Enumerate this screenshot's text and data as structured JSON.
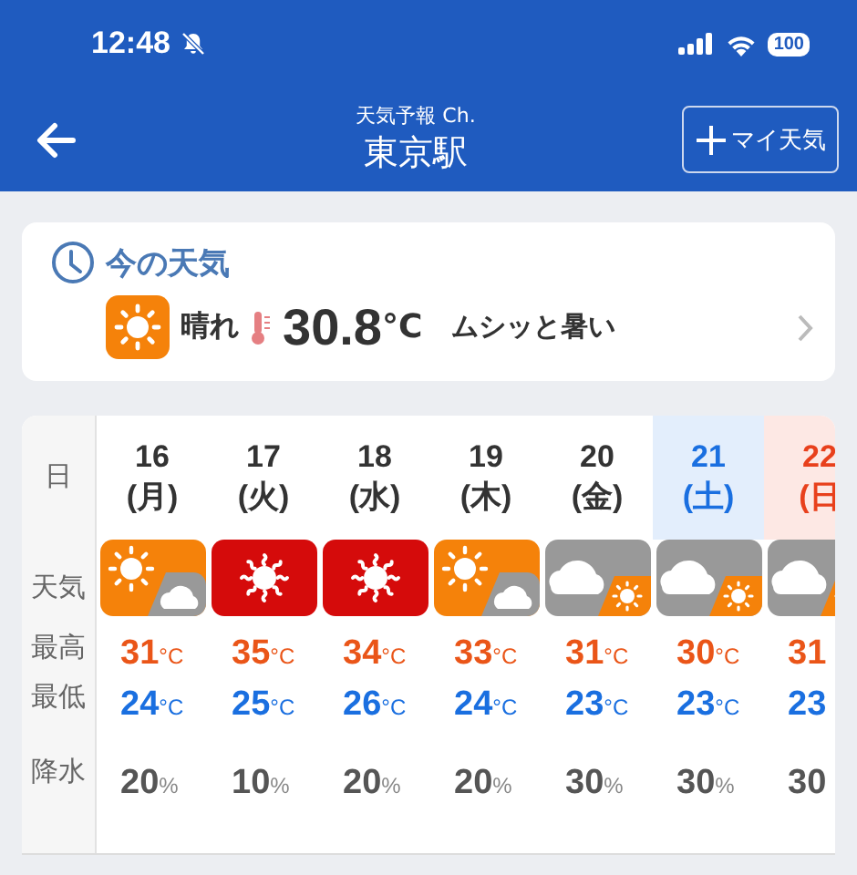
{
  "status_bar": {
    "time": "12:48",
    "battery": "100"
  },
  "header": {
    "subtitle": "天気予報 Ch.",
    "title": "東京駅",
    "add_button": "マイ天気"
  },
  "current": {
    "heading": "今の天気",
    "condition": "晴れ",
    "temperature": "30.8",
    "unit": "°C",
    "feeling": "ムシッと暑い"
  },
  "forecast": {
    "row_labels": [
      "日",
      "天気",
      "最高",
      "最低",
      "降水"
    ],
    "days": [
      {
        "date": "16",
        "weekday": "(月)",
        "kind": "weekday",
        "icon": {
          "kind": "sunny_then_cloudy"
        },
        "high": "31",
        "high_unit": "°C",
        "low": "24",
        "low_unit": "°C",
        "rain": "20",
        "rain_unit": "%"
      },
      {
        "date": "17",
        "weekday": "(火)",
        "kind": "weekday",
        "icon": {
          "kind": "hot"
        },
        "high": "35",
        "high_unit": "°C",
        "low": "25",
        "low_unit": "°C",
        "rain": "10",
        "rain_unit": "%"
      },
      {
        "date": "18",
        "weekday": "(水)",
        "kind": "weekday",
        "icon": {
          "kind": "hot"
        },
        "high": "34",
        "high_unit": "°C",
        "low": "26",
        "low_unit": "°C",
        "rain": "20",
        "rain_unit": "%"
      },
      {
        "date": "19",
        "weekday": "(木)",
        "kind": "weekday",
        "icon": {
          "kind": "sunny_then_cloudy"
        },
        "high": "33",
        "high_unit": "°C",
        "low": "24",
        "low_unit": "°C",
        "rain": "20",
        "rain_unit": "%"
      },
      {
        "date": "20",
        "weekday": "(金)",
        "kind": "weekday",
        "icon": {
          "kind": "cloudy_then_sunny"
        },
        "high": "31",
        "high_unit": "°C",
        "low": "23",
        "low_unit": "°C",
        "rain": "30",
        "rain_unit": "%"
      },
      {
        "date": "21",
        "weekday": "(土)",
        "kind": "saturday",
        "icon": {
          "kind": "cloudy_then_sunny"
        },
        "high": "30",
        "high_unit": "°C",
        "low": "23",
        "low_unit": "°C",
        "rain": "30",
        "rain_unit": "%"
      },
      {
        "date": "22",
        "weekday": "(日",
        "kind": "sunday",
        "icon": {
          "kind": "cloudy_then_sunny"
        },
        "high": "31",
        "low": "23",
        "rain": "30"
      }
    ]
  }
}
